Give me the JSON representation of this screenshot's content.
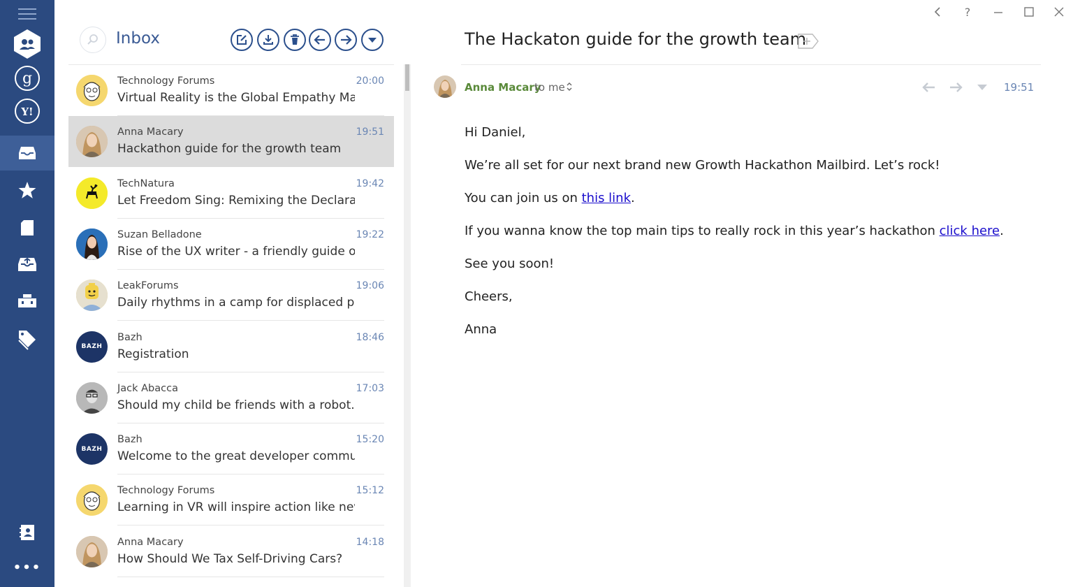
{
  "rail": {
    "items": [
      {
        "icon": "menu-icon"
      },
      {
        "icon": "people-icon"
      },
      {
        "icon": "google-account-icon",
        "glyph": "g"
      },
      {
        "icon": "yahoo-account-icon",
        "glyph": "Y!"
      },
      {
        "icon": "inbox-icon"
      },
      {
        "icon": "star-icon"
      },
      {
        "icon": "drafts-icon"
      },
      {
        "icon": "archive-icon"
      },
      {
        "icon": "folders-icon"
      },
      {
        "icon": "tags-icon"
      },
      {
        "icon": "contacts-icon"
      },
      {
        "icon": "more-icon",
        "glyph": "•••"
      }
    ],
    "bg_color": "#2b4a80",
    "active_color": "#3e5f98"
  },
  "list": {
    "title": "Inbox",
    "toolbar": [
      "compose-icon",
      "download-icon",
      "delete-icon",
      "reply-icon",
      "forward-icon",
      "more-dropdown-icon"
    ],
    "messages": [
      {
        "sender": "Technology Forums",
        "subject": "Virtual Reality is the Global Empathy Ma...",
        "time": "20:00",
        "avatar": "cartoon-face",
        "avatar_bg": "#f5d76e"
      },
      {
        "sender": "Anna Macary",
        "subject": "Hackathon guide for the growth team",
        "time": "19:51",
        "avatar": "photo-woman-blonde",
        "avatar_bg": "#c9a27a",
        "selected": true
      },
      {
        "sender": "TechNatura",
        "subject": "Let Freedom Sing: Remixing the Declarati...",
        "time": "19:42",
        "avatar": "deer-logo",
        "avatar_bg": "#f4ea2a"
      },
      {
        "sender": "Suzan Belladone",
        "subject": "Rise of the UX writer - a friendly guide of...",
        "time": "19:22",
        "avatar": "photo-woman-dark",
        "avatar_bg": "#2a6fb8"
      },
      {
        "sender": "LeakForums",
        "subject": "Daily rhythms in a camp for displaced pe...",
        "time": "19:06",
        "avatar": "photo-lego-head",
        "avatar_bg": "#d8c060"
      },
      {
        "sender": "Bazh",
        "subject": "Registration",
        "time": "18:46",
        "avatar": "bazh-logo",
        "avatar_bg": "#1d3466",
        "glyph": "BAZH"
      },
      {
        "sender": "Jack Abacca",
        "subject": "Should my child be friends with a robot...",
        "time": "17:03",
        "avatar": "photo-man-glasses",
        "avatar_bg": "#9a9a9a"
      },
      {
        "sender": "Bazh",
        "subject": "Welcome to the great developer commu...",
        "time": "15:20",
        "avatar": "bazh-logo",
        "avatar_bg": "#1d3466",
        "glyph": "BAZH"
      },
      {
        "sender": "Technology Forums",
        "subject": "Learning in VR will inspire action like nev...",
        "time": "15:12",
        "avatar": "cartoon-face",
        "avatar_bg": "#f5d76e"
      },
      {
        "sender": "Anna Macary",
        "subject": "How Should We Tax Self-Driving Cars?",
        "time": "14:18",
        "avatar": "photo-woman-blonde",
        "avatar_bg": "#c9a27a"
      }
    ]
  },
  "reader": {
    "title": "The Hackaton guide for the growth team",
    "from_name": "Anna Macary",
    "to_text": "to me",
    "toggle_glyph": "⌃⌄",
    "time": "19:51",
    "window_controls": [
      "back-icon",
      "help-icon",
      "minimize-icon",
      "maximize-icon",
      "close-icon"
    ],
    "help_glyph": "?",
    "body": {
      "greeting": "Hi Daniel,",
      "line1": "We’re all set for our next brand new Growth Hackathon Mailbird. Let’s rock!",
      "line2_pre": "You can join us on ",
      "line2_link": "this link",
      "line2_post": ".",
      "line3_pre": "If you wanna know the top main tips to really rock in this year’s hackathon ",
      "line3_link": "click here",
      "line3_post": ".",
      "line4": "See you soon!",
      "line5": "Cheers,",
      "signature": "Anna"
    },
    "link_color": "#1a0dcc"
  }
}
